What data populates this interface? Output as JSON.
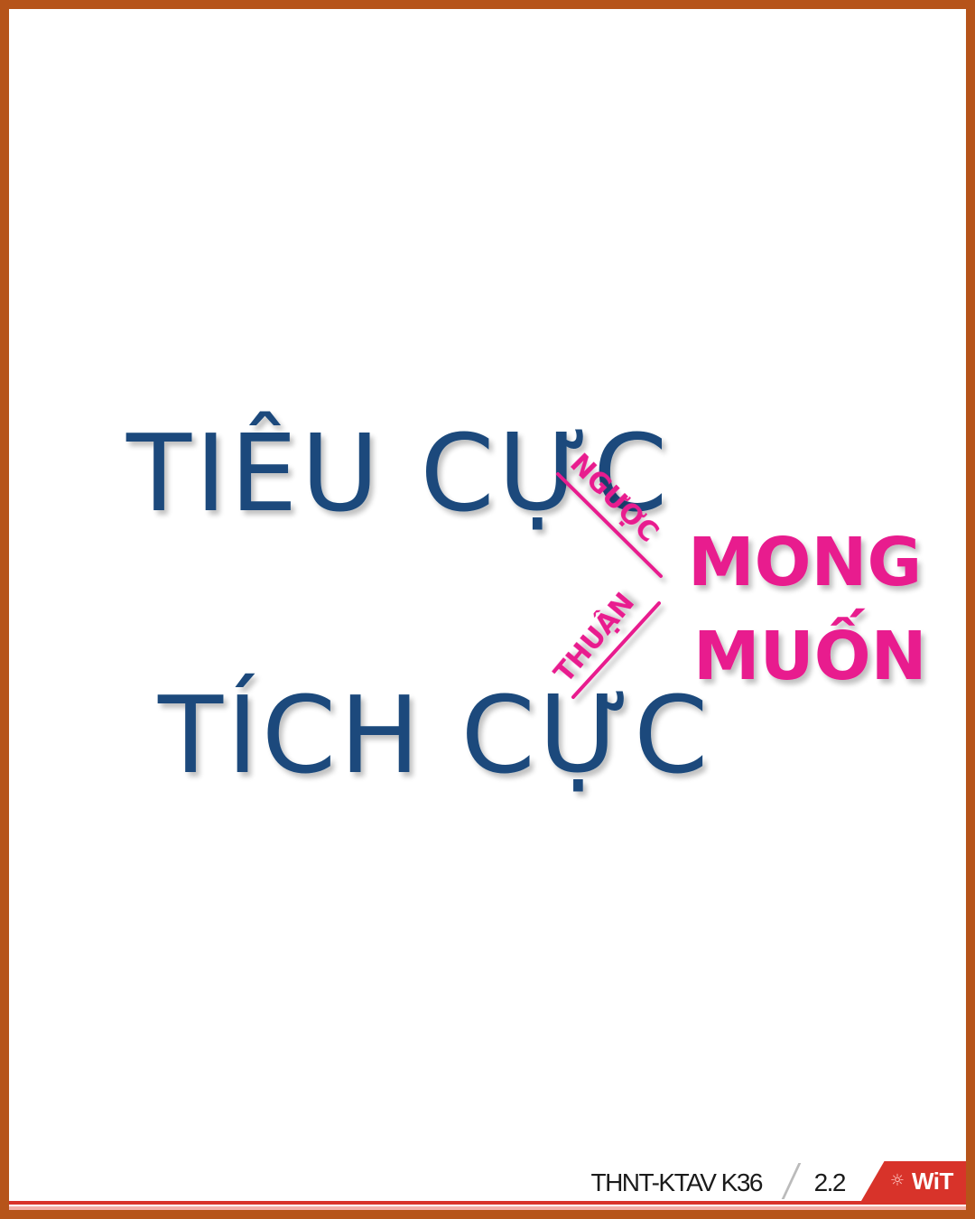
{
  "slide": {
    "handwriting": {
      "line1": "TIÊU CỰC",
      "line2": "TÍCH CỰC",
      "arrow_upper_label": "NGƯỢC",
      "arrow_lower_label": "THUẬN",
      "target_line1": "MONG",
      "target_line2": "MUỐN"
    },
    "colors": {
      "frame": "#b6541a",
      "blue_ink": "#1a4a7c",
      "pink_ink": "#e81a8e",
      "accent_red": "#d8332a"
    }
  },
  "footer": {
    "course_code": "THNT-KTAV K36",
    "slide_number": "2.2",
    "logo_text": "WiT",
    "logo_icon": "sun-icon"
  }
}
